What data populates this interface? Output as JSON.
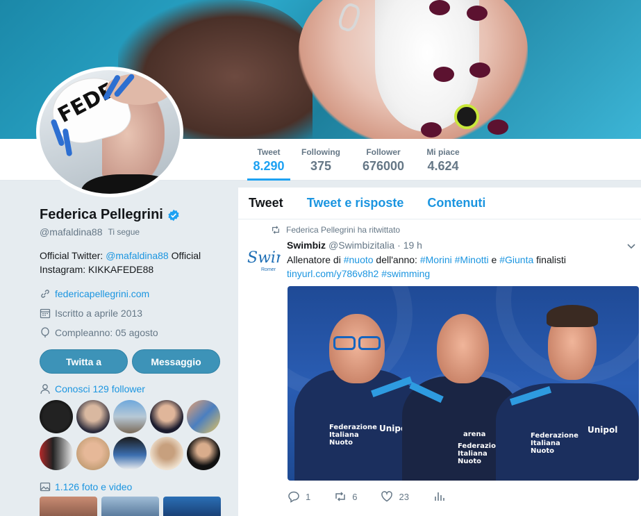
{
  "profile": {
    "name": "Federica Pellegrini",
    "handle": "@mafaldina88",
    "follows_you": "Ti segue",
    "bio_prefix": "Official Twitter: ",
    "bio_link": "@mafaldina88",
    "bio_suffix": " Official Instagram: KIKKAFEDE88",
    "website": "federicapellegrini.com",
    "joined": "Iscritto a aprile 2013",
    "birthday": "Compleanno: 05 agosto",
    "avatar_cap_text": "FEDE"
  },
  "stats": [
    {
      "label": "Tweet",
      "value": "8.290"
    },
    {
      "label": "Following",
      "value": "375"
    },
    {
      "label": "Follower",
      "value": "676000"
    },
    {
      "label": "Mi piace",
      "value": "4.624"
    }
  ],
  "buttons": {
    "tweet_to": "Twitta a",
    "message": "Messaggio"
  },
  "known_followers": "Conosci 129 follower",
  "photos": "1.126 foto e video",
  "tabs": [
    "Tweet",
    "Tweet e risposte",
    "Contenuti"
  ],
  "tweet": {
    "retweeted_by": "Federica Pellegrini ha ritwittato",
    "avatar_text": "Swim",
    "avatar_subtext": "Romer",
    "author": "Swimbiz",
    "author_handle": "@Swimbizitalia",
    "time": "· 19 h",
    "text_1": "Allenatore di ",
    "tag_nuoto": "#nuoto",
    "text_2": " dell'anno: ",
    "tag_morini": "#Morini",
    "tag_minotti": "#Minotti",
    "text_3": " e ",
    "tag_giunta": "#Giunta",
    "text_4": " finalisti",
    "link": "tinyurl.com/y786v8h2",
    "tag_swimming": "#swimming",
    "media_logo_1": "Unipol",
    "media_logo_2": "Unipol",
    "media_fed_1": "Federazione Italiana Nuoto",
    "media_fed_2": "Federazione Italiana Nuoto",
    "media_fed_3": "Federazione Italiana Nuoto",
    "media_arena": "arena",
    "replies": "1",
    "retweets": "6",
    "likes": "23"
  },
  "colors": {
    "accent": "#1da1f2",
    "link": "#1b95e0",
    "button": "#3d93b8"
  }
}
